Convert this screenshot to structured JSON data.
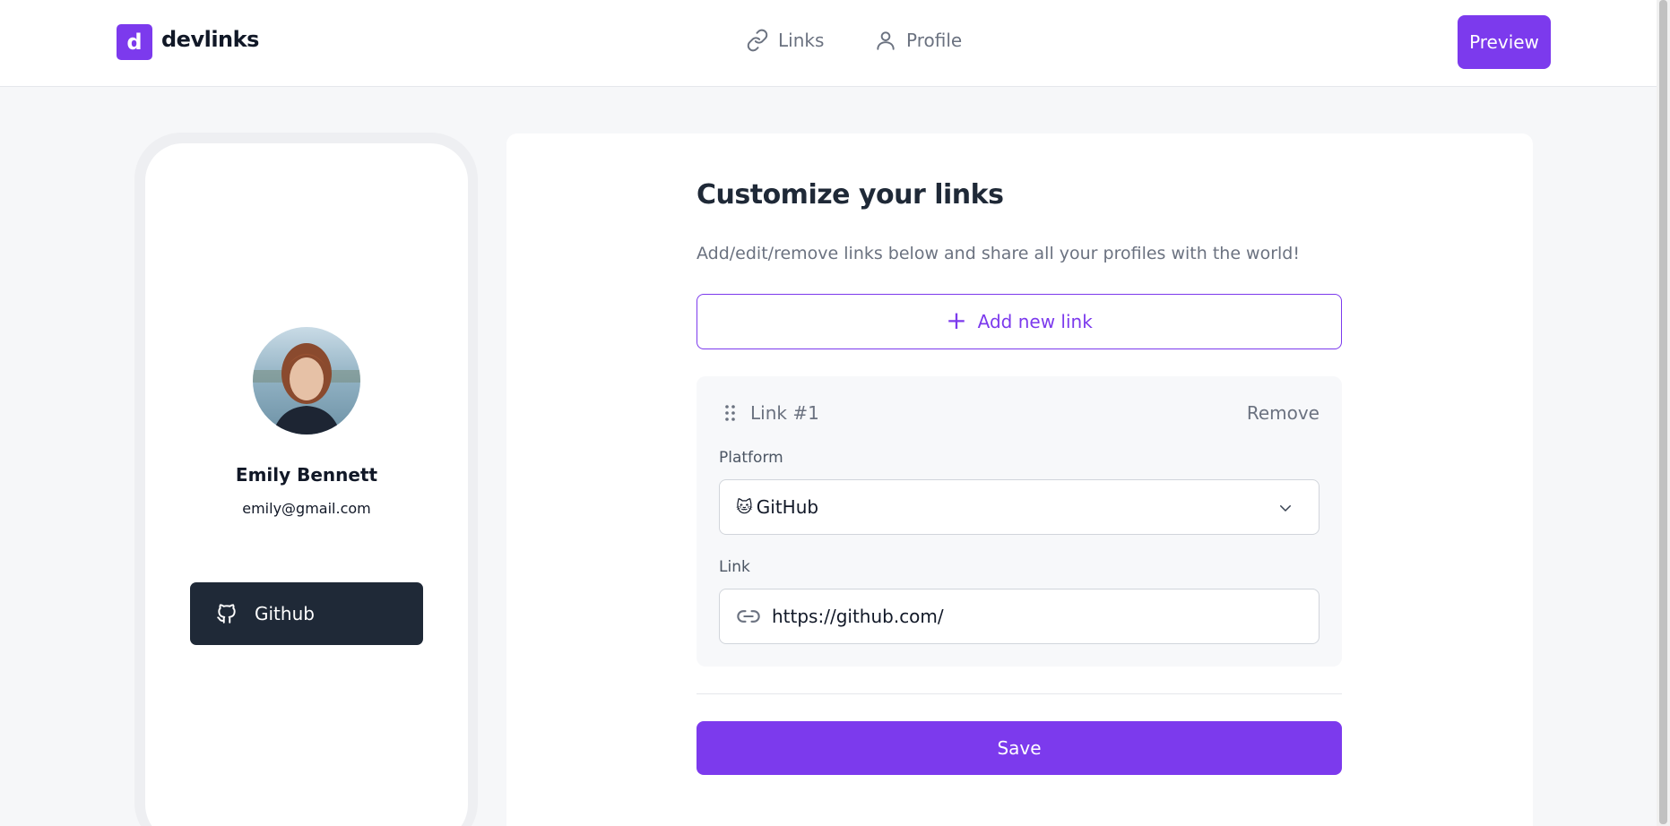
{
  "brand": {
    "logo_letter": "d",
    "name": "devlinks",
    "accent_color": "#7c3aed"
  },
  "nav": {
    "items": [
      {
        "label": "Links",
        "icon": "link-icon"
      },
      {
        "label": "Profile",
        "icon": "user-icon"
      }
    ],
    "preview_label": "Preview"
  },
  "phone": {
    "avatar_icon": "profile-photo",
    "name": "Emily Bennett",
    "email": "emily@gmail.com",
    "links": [
      {
        "platform": "Github",
        "icon": "github-icon",
        "color": "#1f2937"
      }
    ]
  },
  "editor": {
    "title": "Customize your links",
    "subtitle": "Add/edit/remove links below and share all your profiles with the world!",
    "add_link_label": "Add new link",
    "link_items": [
      {
        "heading": "Link #1",
        "remove_label": "Remove",
        "platform_label": "Platform",
        "platform_emoji": "🐱",
        "platform_value": "GitHub",
        "link_label": "Link",
        "link_value": "https://github.com/"
      }
    ],
    "save_label": "Save"
  }
}
